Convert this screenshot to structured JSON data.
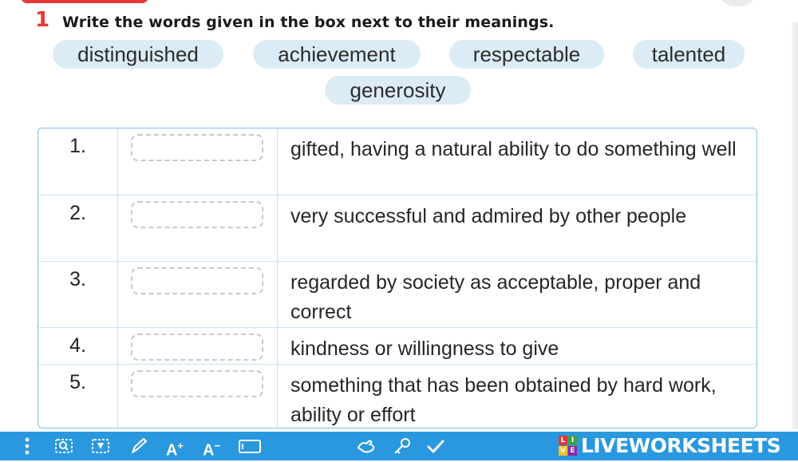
{
  "exercise": {
    "number": "1",
    "instruction": "Write the words given in the box next to their meanings."
  },
  "word_box": [
    "distinguished",
    "achievement",
    "respectable",
    "talented",
    "generosity"
  ],
  "table": {
    "rows": [
      {
        "number": "1.",
        "answer": "",
        "meaning": "gifted, having a natural ability to do something well"
      },
      {
        "number": "2.",
        "answer": "",
        "meaning": "very successful and admired by other people"
      },
      {
        "number": "3.",
        "answer": "",
        "meaning": "regarded by society as acceptable, proper and correct"
      },
      {
        "number": "4.",
        "answer": "",
        "meaning": "kindness or willingness to give"
      },
      {
        "number": "5.",
        "answer": "",
        "meaning": "something that has been obtained by hard work, ability or effort"
      }
    ]
  },
  "toolbar": {
    "icons": [
      "menu-dots-icon",
      "zoom-icon",
      "highlight-icon",
      "pen-icon",
      "font-increase-icon",
      "font-decrease-icon",
      "text-box-icon",
      "drag-icon",
      "key-icon",
      "check-icon"
    ],
    "font_increase_label": "A",
    "font_decrease_label": "A",
    "brand_name": "LIVEWORKSHEETS",
    "brand_logo_letters": [
      "L",
      "I",
      "V",
      "E"
    ],
    "brand_color": "#2a98de"
  },
  "colors": {
    "accent_red": "#e53935",
    "pill_background": "#dcecf6",
    "table_border": "#7fc1e3"
  }
}
